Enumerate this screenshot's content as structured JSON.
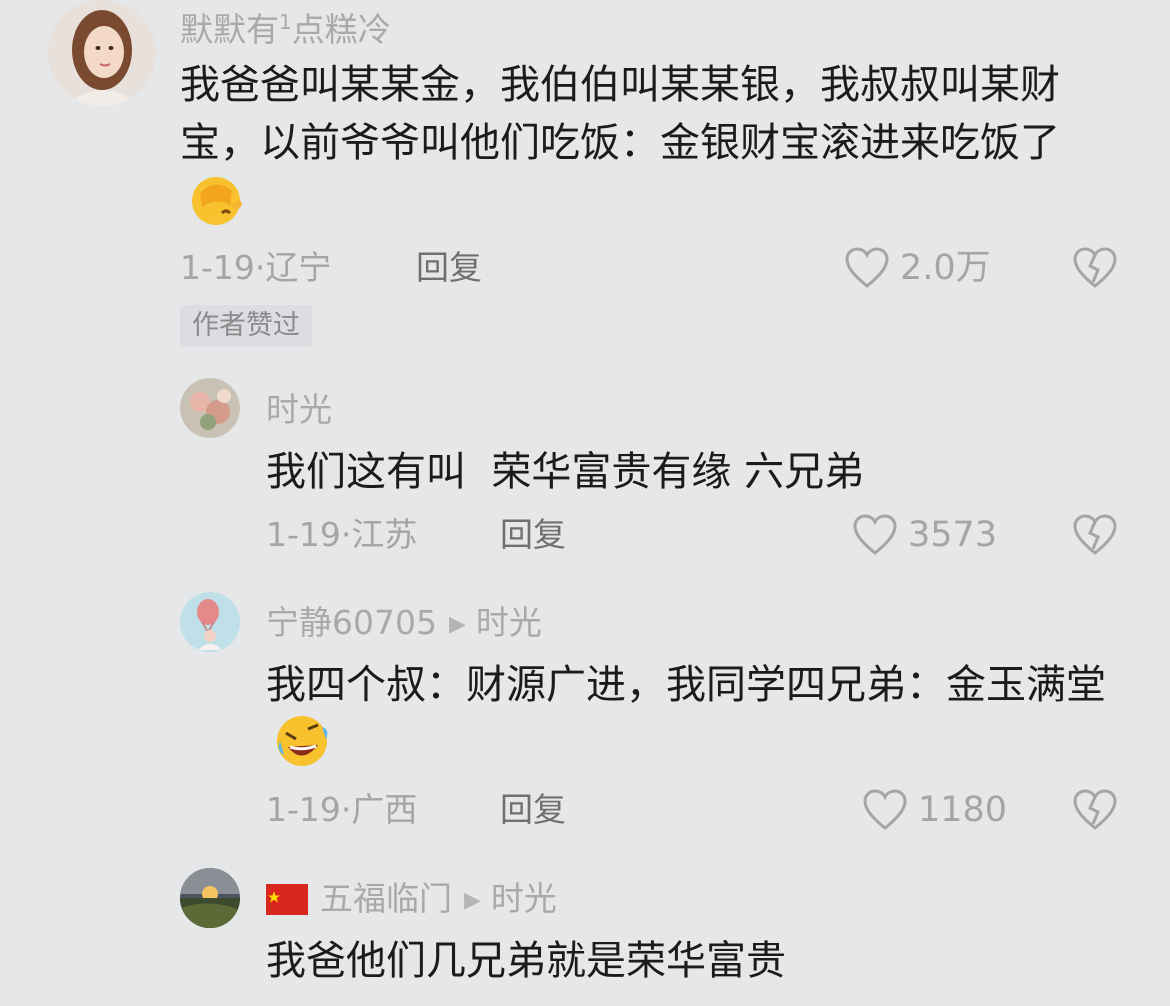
{
  "comments": [
    {
      "username": "默默有",
      "username_sup": "1",
      "username_suffix": "点糕冷",
      "text": "我爸爸叫某某金，我伯伯叫某某银，我叔叔叫某财宝，以前爷爷叫他们吃饭：金银财宝滚进来吃饭了",
      "date": "1-19·",
      "location": "辽宁",
      "reply_label": "回复",
      "likes": "2.0万",
      "badge": "作者赞过",
      "emoji": "facepalm-emoji"
    },
    {
      "username": "时光",
      "text": "我们这有叫  荣华富贵有缘 六兄弟",
      "date": "1-19·",
      "location": "江苏",
      "reply_label": "回复",
      "likes": "3573"
    },
    {
      "username": "宁静60705",
      "reply_to": "时光",
      "text": "我四个叔：财源广进，我同学四兄弟：金玉满堂",
      "date": "1-19·",
      "location": "广西",
      "reply_label": "回复",
      "likes": "1180",
      "emoji": "rolling-laughing-emoji"
    },
    {
      "username": "五福临门",
      "reply_to": "时光",
      "text": "我爸他们几兄弟就是荣华富贵",
      "flag": "china-flag"
    }
  ],
  "colors": {
    "background": "#e6e7e9",
    "text": "#1b1b1d",
    "muted": "#a4a5a7",
    "flag_red": "#d8271c"
  }
}
